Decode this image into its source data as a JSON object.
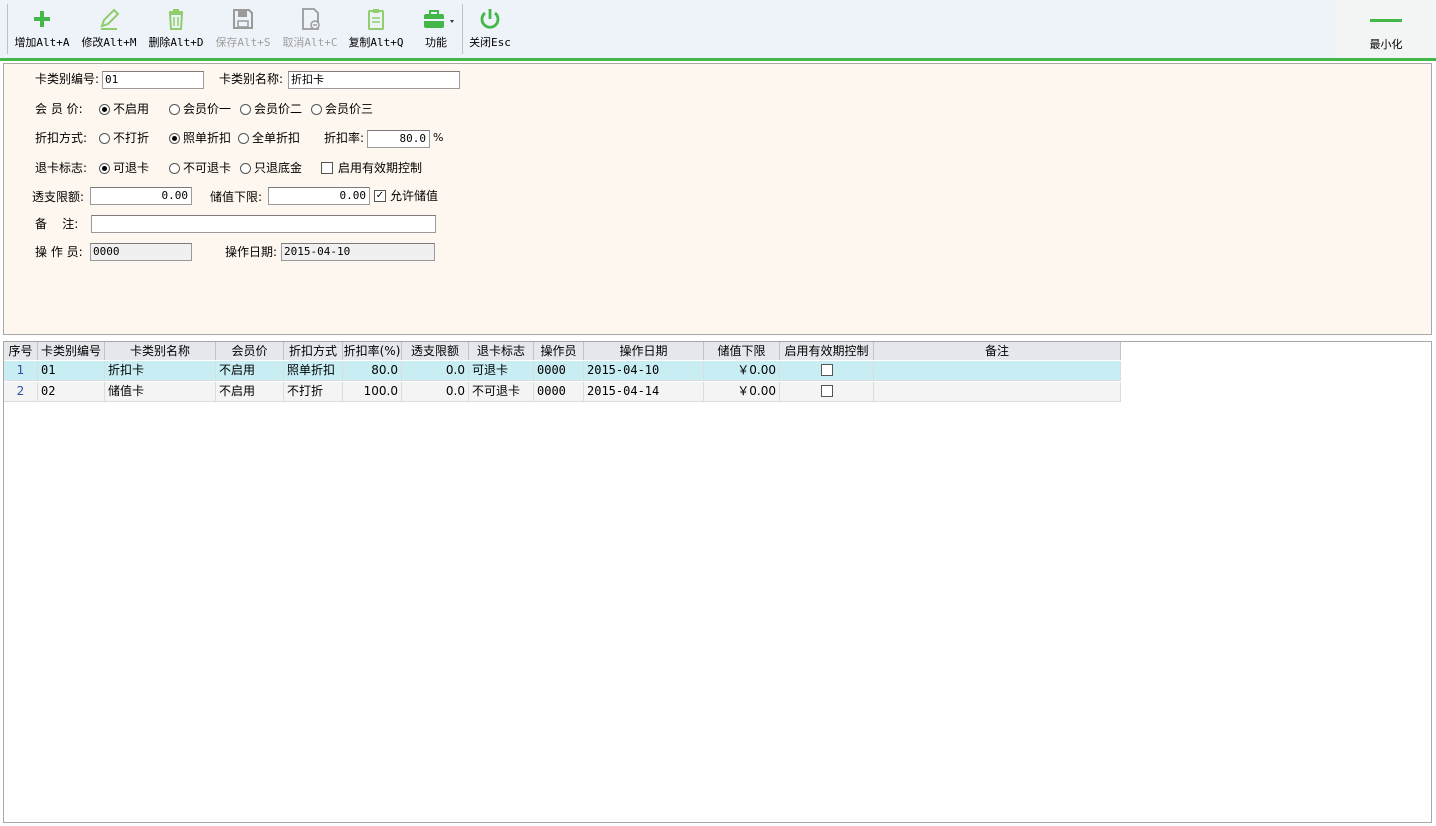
{
  "toolbar": {
    "add_label": "增加Alt+A",
    "edit_label": "修改Alt+M",
    "delete_label": "删除Alt+D",
    "save_label": "保存Alt+S",
    "cancel_label": "取消Alt+C",
    "copy_label": "复制Alt+Q",
    "func_label": "功能",
    "close_label": "关闭Esc",
    "minimize_label": "最小化"
  },
  "form": {
    "code_label": "卡类别编号:",
    "code_value": "01",
    "name_label": "卡类别名称:",
    "name_value": "折扣卡",
    "member_price_label": "会 员 价:",
    "member_price_options": [
      "不启用",
      "会员价一",
      "会员价二",
      "会员价三"
    ],
    "discount_mode_label": "折扣方式:",
    "discount_mode_options": [
      "不打折",
      "照单折扣",
      "全单折扣"
    ],
    "discount_rate_label": "折扣率:",
    "discount_rate_value": "80.0",
    "percent_sign": "%",
    "refund_label": "退卡标志:",
    "refund_options": [
      "可退卡",
      "不可退卡",
      "只退底金"
    ],
    "validity_label": "启用有效期控制",
    "overdraft_label": "透支限额:",
    "overdraft_value": "0.00",
    "min_balance_label": "储值下限:",
    "min_balance_value": "0.00",
    "allow_stored_label": "允许储值",
    "remark_label": "备    注:",
    "remark_value": "",
    "operator_label": "操 作 员:",
    "operator_value": "0000",
    "op_date_label": "操作日期:",
    "op_date_value": "2015-04-10"
  },
  "grid": {
    "headers": [
      "序号",
      "卡类别编号",
      "卡类别名称",
      "会员价",
      "折扣方式",
      "折扣率(%)",
      "透支限额",
      "退卡标志",
      "操作员",
      "操作日期",
      "储值下限",
      "启用有效期控制",
      "备注"
    ],
    "rows": [
      [
        "1",
        "01",
        "折扣卡",
        "不启用",
        "照单折扣",
        "80.0",
        "0.0",
        "可退卡",
        "0000",
        "2015-04-10",
        "￥0.00",
        "",
        ""
      ],
      [
        "2",
        "02",
        "储值卡",
        "不启用",
        "不打折",
        "100.0",
        "0.0",
        "不可退卡",
        "0000",
        "2015-04-14",
        "￥0.00",
        "",
        ""
      ]
    ]
  },
  "colors": {
    "accent_green": "#43b749",
    "selected_row": "#c8eef4",
    "form_bg": "#fef7ef"
  }
}
